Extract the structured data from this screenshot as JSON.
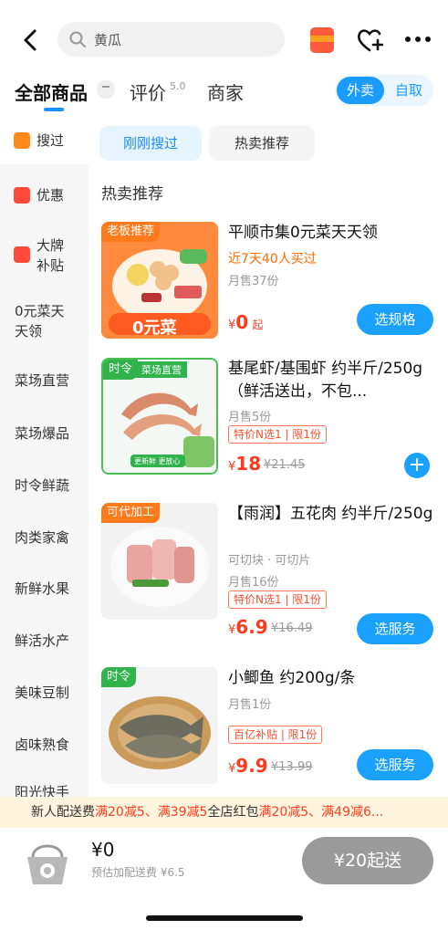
{
  "search": {
    "query": "黄瓜"
  },
  "tabs": {
    "all": "全部商品",
    "reviews": "评价",
    "review_score": "5.0",
    "merchant": "商家"
  },
  "mode_toggle": {
    "delivery": "外卖",
    "pickup": "自取"
  },
  "sidebar": {
    "items": [
      "搜过",
      "优惠",
      "大牌",
      "补贴",
      "0元菜天",
      "天领",
      "菜场直营",
      "菜场爆品",
      "时令鲜蔬",
      "肉类家禽",
      "新鲜水果",
      "鲜活水产",
      "美味豆制",
      "卤味熟食",
      "阳光快手"
    ]
  },
  "chips": {
    "recent": "刚刚搜过",
    "hot": "热卖推荐"
  },
  "section_title": "热卖推荐",
  "products": [
    {
      "tag": "老板推荐",
      "thumb_text": "0元菜",
      "title": "平顺市集0元菜天天领",
      "highlight": "近7天40人买过",
      "sales": "月售37份",
      "price_symbol": "¥",
      "price": "0",
      "price_suffix": "起",
      "button": "选规格"
    },
    {
      "tag": "时令",
      "tag2": "菜场直营",
      "thumb_text": "更新鲜 更放心",
      "title": "基尾虾/基围虾 约半斤/250g（鲜活送出，不包...",
      "sales": "月售5份",
      "promo": "特价N选1 | 限1份",
      "price_symbol": "¥",
      "price": "18",
      "orig_price": "¥21.45"
    },
    {
      "tag": "可代加工",
      "title": "【雨润】五花肉 约半斤/250g",
      "spec": "可切块 · 可切片",
      "sales": "月售16份",
      "promo": "特价N选1 | 限1份",
      "price_symbol": "¥",
      "price": "6.9",
      "orig_price": "¥16.49",
      "button": "选服务"
    },
    {
      "tag": "时令",
      "title": "小鲫鱼 约200g/条",
      "sales": "月售1份",
      "promo": "百亿补贴 | 限1份",
      "price_symbol": "¥",
      "price": "9.9",
      "orig_price": "¥13.99",
      "button": "选服务"
    }
  ],
  "promo_bar": {
    "prefix": "新人配送费",
    "p1": "满20减5、满39减5",
    "mid": "全店红包",
    "p2": "满20减5、满49减6..."
  },
  "cart": {
    "total": "¥0",
    "fee": "预估加配送费 ¥6.5",
    "checkout": "¥20起送"
  },
  "colors": {
    "accent": "#1aa0ff",
    "price": "#ff3b1f",
    "tag_orange": "#ff7a1a",
    "tag_green": "#2fb34a"
  }
}
